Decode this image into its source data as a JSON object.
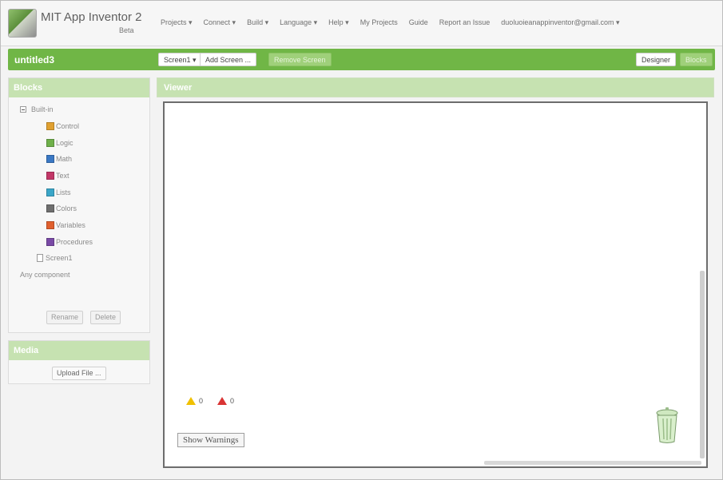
{
  "app": {
    "title": "MIT App Inventor 2",
    "beta": "Beta"
  },
  "menu": [
    "Projects ▾",
    "Connect ▾",
    "Build ▾",
    "Language ▾",
    "Help ▾",
    "My Projects",
    "Guide",
    "Report an Issue",
    "duoluoieanappinventor@gmail.com ▾"
  ],
  "project": {
    "name": "untitled3",
    "screen_select": "Screen1 ▾",
    "add_screen": "Add Screen ...",
    "remove_screen": "Remove Screen",
    "designer": "Designer",
    "blocks": "Blocks"
  },
  "blocks_panel": {
    "title": "Blocks",
    "builtin": "Built-in",
    "items": [
      {
        "label": "Control",
        "color": "#e0a030"
      },
      {
        "label": "Logic",
        "color": "#6fb04a"
      },
      {
        "label": "Math",
        "color": "#3a78c4"
      },
      {
        "label": "Text",
        "color": "#c23768"
      },
      {
        "label": "Lists",
        "color": "#3aa6c8"
      },
      {
        "label": "Colors",
        "color": "#6e6e6e"
      },
      {
        "label": "Variables",
        "color": "#e0602e"
      },
      {
        "label": "Procedures",
        "color": "#7a4aa6"
      }
    ],
    "screen": "Screen1",
    "any_component": "Any component",
    "rename": "Rename",
    "delete": "Delete"
  },
  "media_panel": {
    "title": "Media",
    "upload": "Upload File ..."
  },
  "viewer": {
    "title": "Viewer",
    "warnings_count": "0",
    "errors_count": "0",
    "show_warnings": "Show Warnings"
  },
  "colors": {
    "accent_green": "#70b646",
    "light_green": "#c6e2b1"
  }
}
